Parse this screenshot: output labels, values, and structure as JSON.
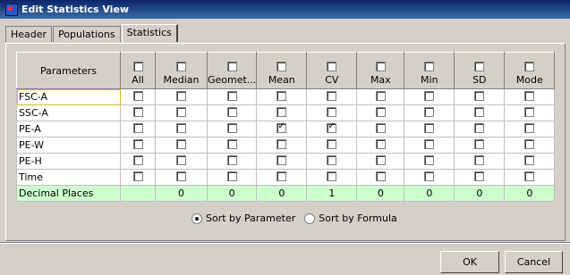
{
  "window": {
    "title": "Edit Statistics View"
  },
  "tabs": [
    {
      "label": "Header"
    },
    {
      "label": "Populations"
    },
    {
      "label": "Statistics"
    }
  ],
  "table": {
    "header_first": "Parameters",
    "columns": [
      {
        "label": "All"
      },
      {
        "label": "Median"
      },
      {
        "label": "Geomet..."
      },
      {
        "label": "Mean"
      },
      {
        "label": "CV"
      },
      {
        "label": "Max"
      },
      {
        "label": "Min"
      },
      {
        "label": "SD"
      },
      {
        "label": "Mode"
      }
    ],
    "rows": [
      {
        "label": "FSC-A",
        "checks": [
          false,
          false,
          false,
          false,
          false,
          false,
          false,
          false,
          false
        ]
      },
      {
        "label": "SSC-A",
        "checks": [
          false,
          false,
          false,
          false,
          false,
          false,
          false,
          false,
          false
        ]
      },
      {
        "label": "PE-A",
        "checks": [
          false,
          false,
          false,
          true,
          true,
          false,
          false,
          false,
          false
        ]
      },
      {
        "label": "PE-W",
        "checks": [
          false,
          false,
          false,
          false,
          false,
          false,
          false,
          false,
          false
        ]
      },
      {
        "label": "PE-H",
        "checks": [
          false,
          false,
          false,
          false,
          false,
          false,
          false,
          false,
          false
        ]
      },
      {
        "label": "Time",
        "checks": [
          false,
          false,
          false,
          false,
          false,
          false,
          false,
          false,
          false
        ]
      }
    ],
    "decimal_label": "Decimal Places",
    "decimals": [
      "",
      "0",
      "0",
      "0",
      "1",
      "0",
      "0",
      "0",
      "0"
    ]
  },
  "sort": {
    "by_parameter": "Sort by Parameter",
    "by_formula": "Sort by Formula",
    "selected": "parameter"
  },
  "buttons": {
    "ok": "OK",
    "cancel": "Cancel"
  }
}
